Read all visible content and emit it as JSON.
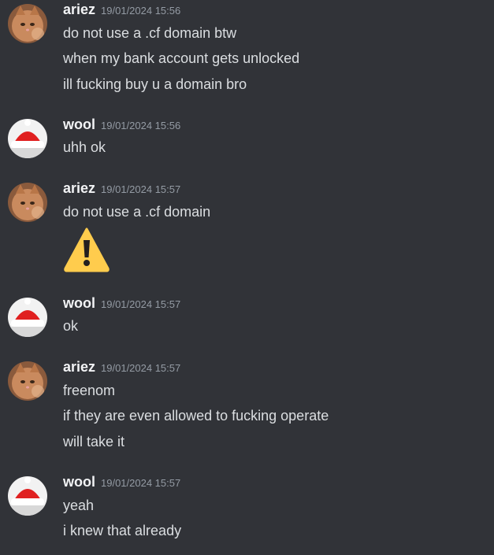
{
  "messages": [
    {
      "user": "ariez",
      "avatar_icon": "cat-avatar-icon",
      "timestamp": "19/01/2024 15:56",
      "lines": [
        "do not use a .cf domain btw",
        "when my bank account gets unlocked",
        "ill fucking buy u a domain bro"
      ]
    },
    {
      "user": "wool",
      "avatar_icon": "santa-hat-avatar-icon",
      "timestamp": "19/01/2024 15:56",
      "lines": [
        "uhh ok"
      ]
    },
    {
      "user": "ariez",
      "avatar_icon": "cat-avatar-icon",
      "timestamp": "19/01/2024 15:57",
      "lines": [
        "do not use a .cf domain"
      ],
      "emoji": "warning-emoji-icon"
    },
    {
      "user": "wool",
      "avatar_icon": "santa-hat-avatar-icon",
      "timestamp": "19/01/2024 15:57",
      "lines": [
        "ok"
      ]
    },
    {
      "user": "ariez",
      "avatar_icon": "cat-avatar-icon",
      "timestamp": "19/01/2024 15:57",
      "lines": [
        "freenom",
        "if they are even allowed to fucking operate",
        "will take it"
      ]
    },
    {
      "user": "wool",
      "avatar_icon": "santa-hat-avatar-icon",
      "timestamp": "19/01/2024 15:57",
      "lines": [
        "yeah",
        "i knew that already"
      ]
    }
  ],
  "colors": {
    "background": "#313338",
    "username": "#f2f3f5",
    "timestamp": "#949ba4",
    "message_text": "#dbdee1",
    "warning_yellow": "#ffcc4d"
  }
}
